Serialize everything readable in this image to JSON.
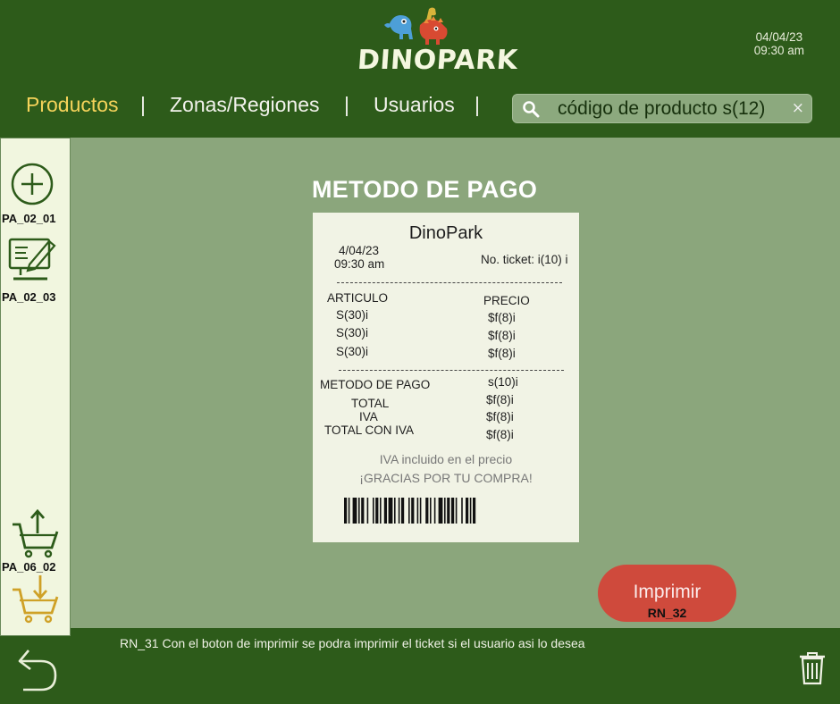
{
  "header": {
    "logo_text": "DINOPARK",
    "date": "04/04/23",
    "time": "09:30 am"
  },
  "nav": {
    "items": [
      "Productos",
      "Zonas/Regiones",
      "Usuarios"
    ],
    "separator": "|"
  },
  "search": {
    "value": "código de producto s(12)",
    "clear_glyph": "×"
  },
  "sidebar": {
    "items": [
      {
        "label": "PA_02_01",
        "icon": "add-circle-icon"
      },
      {
        "label": "PA_02_03",
        "icon": "edit-document-icon"
      },
      {
        "label": "PA_06_02",
        "icon": "cart-upload-icon"
      },
      {
        "label": "",
        "icon": "cart-download-icon"
      }
    ]
  },
  "page": {
    "title": "METODO DE PAGO"
  },
  "ticket": {
    "store": "DinoPark",
    "date": "4/04/23",
    "time": "09:30 am",
    "ticket_no": "No. ticket: i(10) i",
    "dashes": "------------------------------------------",
    "col_item": "ARTICULO",
    "col_price": "PRECIO",
    "items": [
      {
        "name": "S(30)i",
        "price": "$f(8)i"
      },
      {
        "name": "S(30)i",
        "price": "$f(8)i"
      },
      {
        "name": "S(30)i",
        "price": "$f(8)i"
      }
    ],
    "payment_label": "METODO DE PAGO",
    "payment_value": "s(10)i",
    "total_label": "TOTAL",
    "total_value": "$f(8)i",
    "iva_label": "IVA",
    "iva_value": "$f(8)i",
    "total_iva_label": "TOTAL CON IVA",
    "total_iva_value": "$f(8)i",
    "iva_note": "IVA incluido en el precio",
    "thanks": "¡GRACIAS POR TU COMPRA!"
  },
  "actions": {
    "print_label": "Imprimir",
    "print_code": "RN_32"
  },
  "footer": {
    "note": "RN_31 Con el boton de imprimir se podra imprimir el ticket si el usuario asi lo desea"
  },
  "colors": {
    "header_bg": "#2d5b1a",
    "main_bg": "#8ba67c",
    "sidebar_bg": "#f1f6df",
    "active_nav": "#f5d35a",
    "print_button": "#cf4a3c",
    "ticket_bg": "#f1f3e5"
  }
}
